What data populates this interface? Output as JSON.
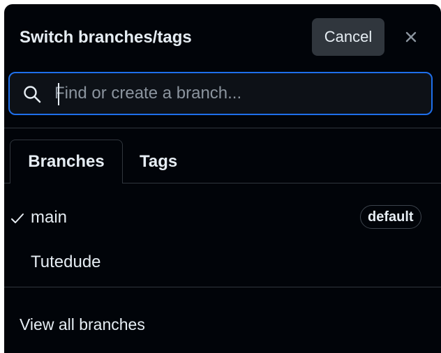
{
  "header": {
    "title": "Switch branches/tags",
    "cancel_label": "Cancel",
    "close_icon": "close-icon"
  },
  "search": {
    "placeholder": "Find or create a branch...",
    "value": "",
    "icon": "search-icon"
  },
  "tabs": [
    {
      "label": "Branches",
      "selected": true
    },
    {
      "label": "Tags",
      "selected": false
    }
  ],
  "branches": [
    {
      "name": "main",
      "checked": true,
      "badge": "default"
    },
    {
      "name": "Tutedude",
      "checked": false,
      "badge": ""
    }
  ],
  "footer": {
    "view_all_label": "View all branches"
  },
  "colors": {
    "background": "#010409",
    "focus_border": "#1f6feb",
    "button_bg": "#30363d",
    "text": "#e6edf3",
    "muted_text": "#8b949e"
  }
}
